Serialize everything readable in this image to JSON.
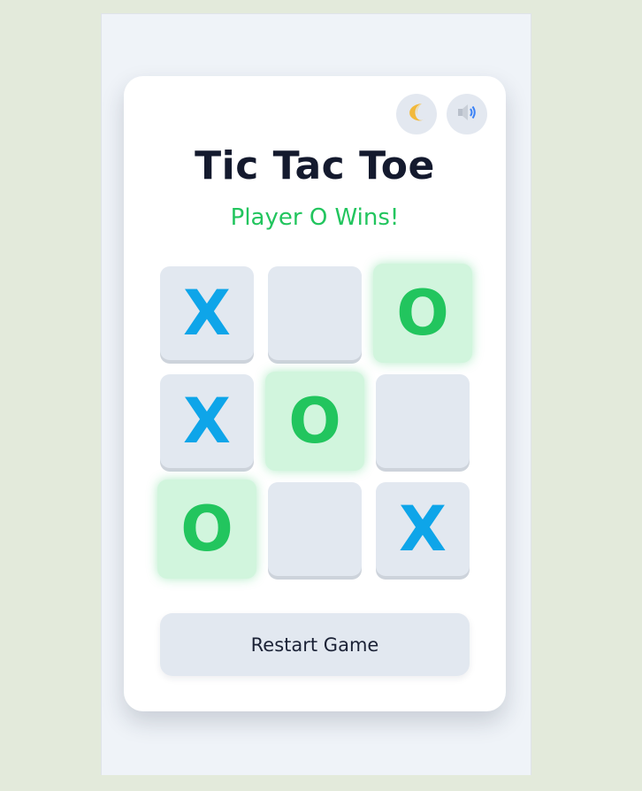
{
  "title": "Tic Tac Toe",
  "status": "Player O Wins!",
  "controls": {
    "theme_icon": "crescent-moon-icon",
    "sound_icon": "speaker-icon"
  },
  "board": {
    "cells": [
      "X",
      "",
      "O",
      "X",
      "O",
      "",
      "O",
      "",
      "X"
    ],
    "winning_cells": [
      2,
      4,
      6
    ]
  },
  "restart_label": "Restart Game",
  "colors": {
    "x": "#0ea5e9",
    "o": "#22c55e",
    "win_highlight": "#d1f5dd"
  }
}
